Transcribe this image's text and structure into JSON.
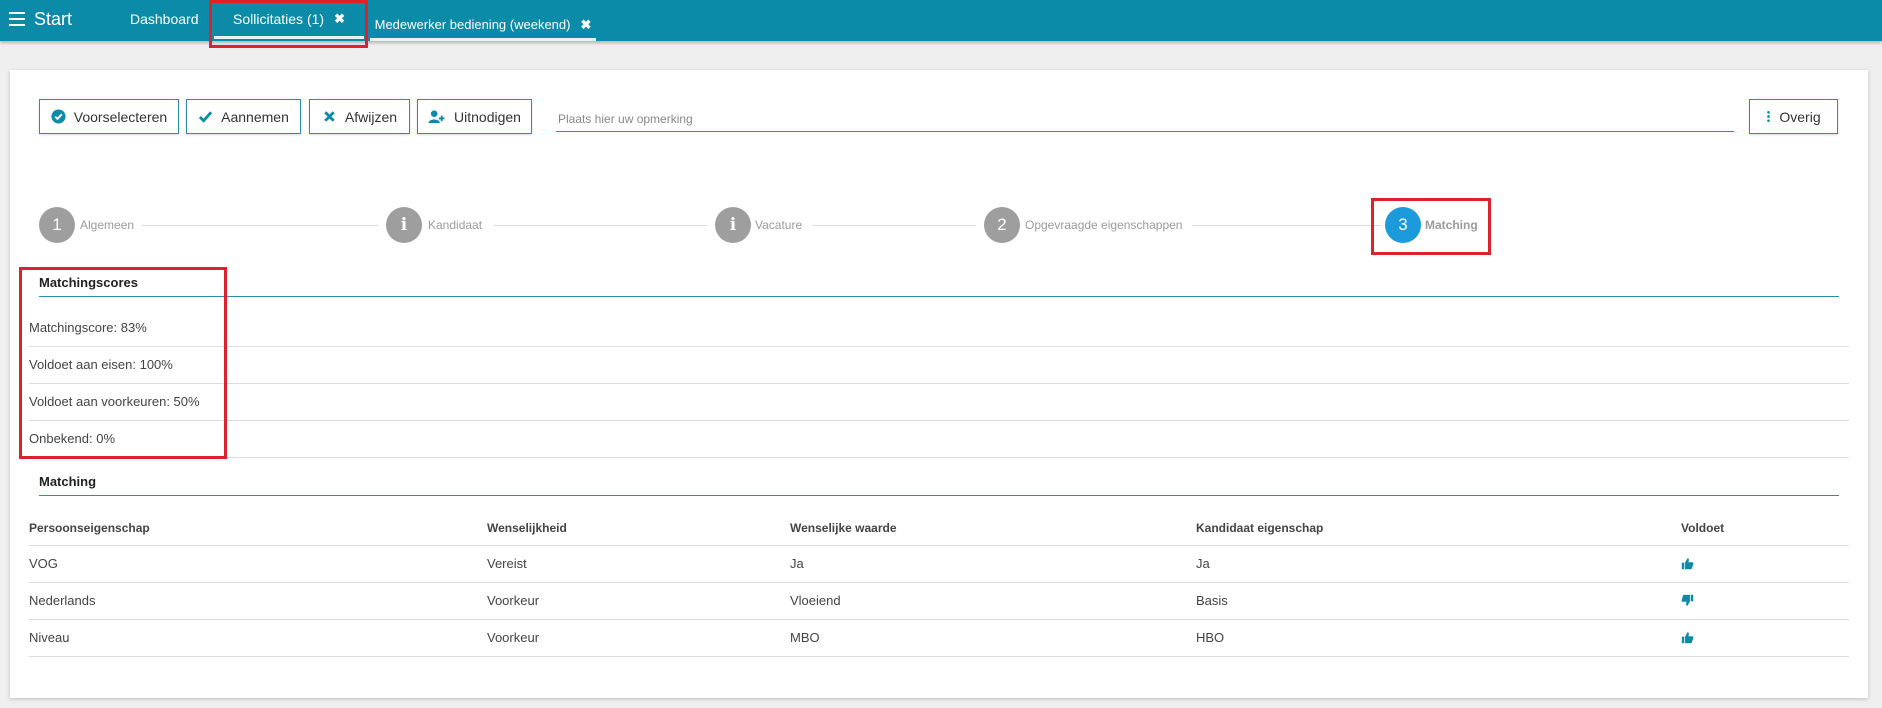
{
  "nav": {
    "start_label": "Start",
    "tabs": [
      {
        "label": "Dashboard"
      },
      {
        "label": "Sollicitaties (1)"
      },
      {
        "label": "Medewerker bediening (weekend)"
      }
    ],
    "close_glyph": "✖"
  },
  "toolbar": {
    "buttons": [
      {
        "label": "Voorselecteren",
        "icon": "check-circle-icon"
      },
      {
        "label": "Aannemen",
        "icon": "check-icon"
      },
      {
        "label": "Afwijzen",
        "icon": "times-icon"
      },
      {
        "label": "Uitnodigen",
        "icon": "user-plus-icon"
      }
    ],
    "remark_placeholder": "Plaats hier uw opmerking",
    "more_label": "Overig"
  },
  "stepper": {
    "steps": [
      {
        "badge": "1",
        "label": "Algemeen"
      },
      {
        "badge": "i",
        "label": "Kandidaat"
      },
      {
        "badge": "i",
        "label": "Vacature"
      },
      {
        "badge": "2",
        "label": "Opgevraagde eigenschappen"
      },
      {
        "badge": "3",
        "label": "Matching"
      }
    ]
  },
  "scores": {
    "title": "Matchingscores",
    "rows": [
      "Matchingscore: 83%",
      "Voldoet aan eisen: 100%",
      "Voldoet aan voorkeuren: 50%",
      "Onbekend: 0%"
    ]
  },
  "matching": {
    "title": "Matching",
    "headers": [
      "Persoonseigenschap",
      "Wenselijkheid",
      "Wenselijke waarde",
      "Kandidaat eigenschap",
      "Voldoet"
    ],
    "rows": [
      {
        "property": "VOG",
        "desirability": "Vereist",
        "desired": "Ja",
        "candidate": "Ja",
        "voldoet": "thumbs-up-icon"
      },
      {
        "property": "Nederlands",
        "desirability": "Voorkeur",
        "desired": "Vloeiend",
        "candidate": "Basis",
        "voldoet": "thumbs-down-icon"
      },
      {
        "property": "Niveau",
        "desirability": "Voorkeur",
        "desired": "MBO",
        "candidate": "HBO",
        "voldoet": "thumbs-up-icon"
      }
    ]
  },
  "colors": {
    "topbar": "#0b8ba8",
    "accent": "#2a8ea8",
    "step_active": "#1b9bdc",
    "step_inactive": "#9e9e9e",
    "highlight": "#e0202a"
  }
}
